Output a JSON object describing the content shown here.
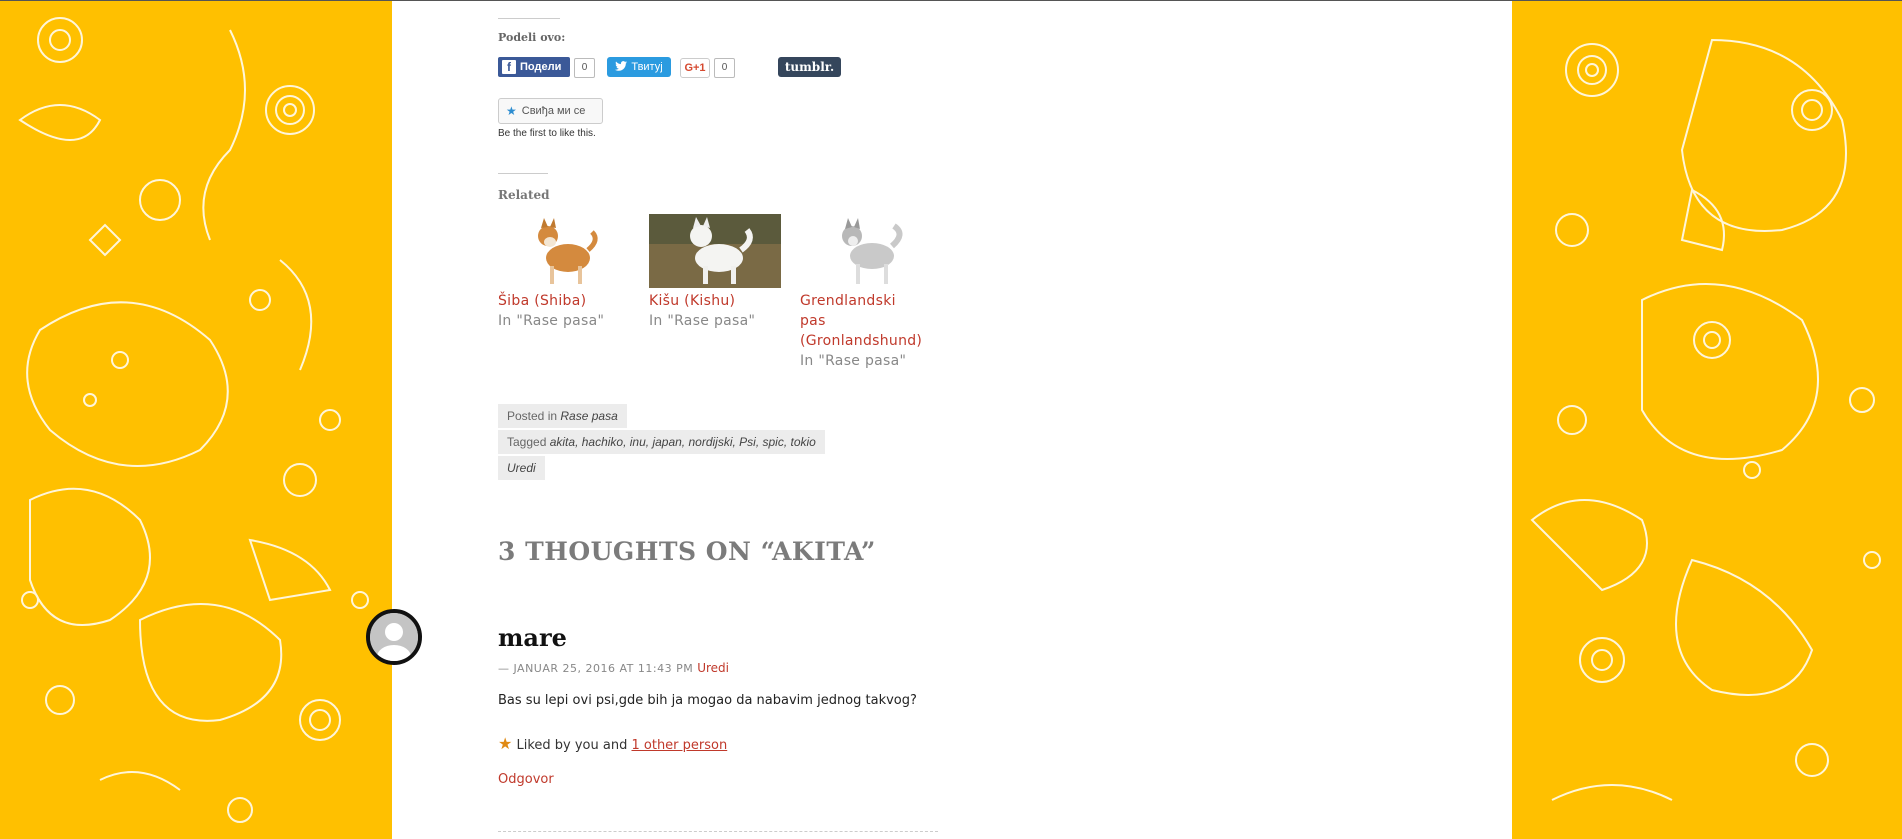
{
  "share": {
    "heading": "Podeli ovo:",
    "facebook_label": "Подели",
    "facebook_count": "0",
    "twitter_label": "Твитуј",
    "gplus_label": "G+1",
    "gplus_count": "0",
    "tumblr_label": "tumblr."
  },
  "like": {
    "button_label": "Свиђа ми се",
    "first_text": "Be the first to like this."
  },
  "related": {
    "heading": "Related",
    "items": [
      {
        "title": "Šiba (Shiba)",
        "category": "In \"Rase pasa\""
      },
      {
        "title": "Kišu (Kishu)",
        "category": "In \"Rase pasa\""
      },
      {
        "title_lines": [
          "Grendlandski",
          "pas",
          "(Gronlandshund)"
        ],
        "category": "In \"Rase pasa\""
      }
    ]
  },
  "post_meta": {
    "posted_in_label": "Posted in",
    "category": "Rase pasa",
    "tagged_label": "Tagged",
    "tags": "akita, hachiko, inu, japan, nordijski, Psi, spic, tokio",
    "edit_label": "Uredi"
  },
  "comments": {
    "heading": "3 THOUGHTS ON “AKITA”",
    "first": {
      "author": "mare",
      "date": "— JANUAR 25, 2016 AT 11:43 PM",
      "edit": "Uredi",
      "text": "Bas su lepi ovi psi,gde bih ja mogao da nabavim jednog takvog?",
      "liked_prefix": "Liked by you and",
      "liked_link": "1 other person",
      "reply": "Odgovor"
    }
  },
  "colors": {
    "background_yellow": "#ffc000",
    "link_red": "#c0392b",
    "facebook_blue": "#3b5998",
    "twitter_blue": "#2b9be0",
    "tumblr_navy": "#35465c"
  }
}
